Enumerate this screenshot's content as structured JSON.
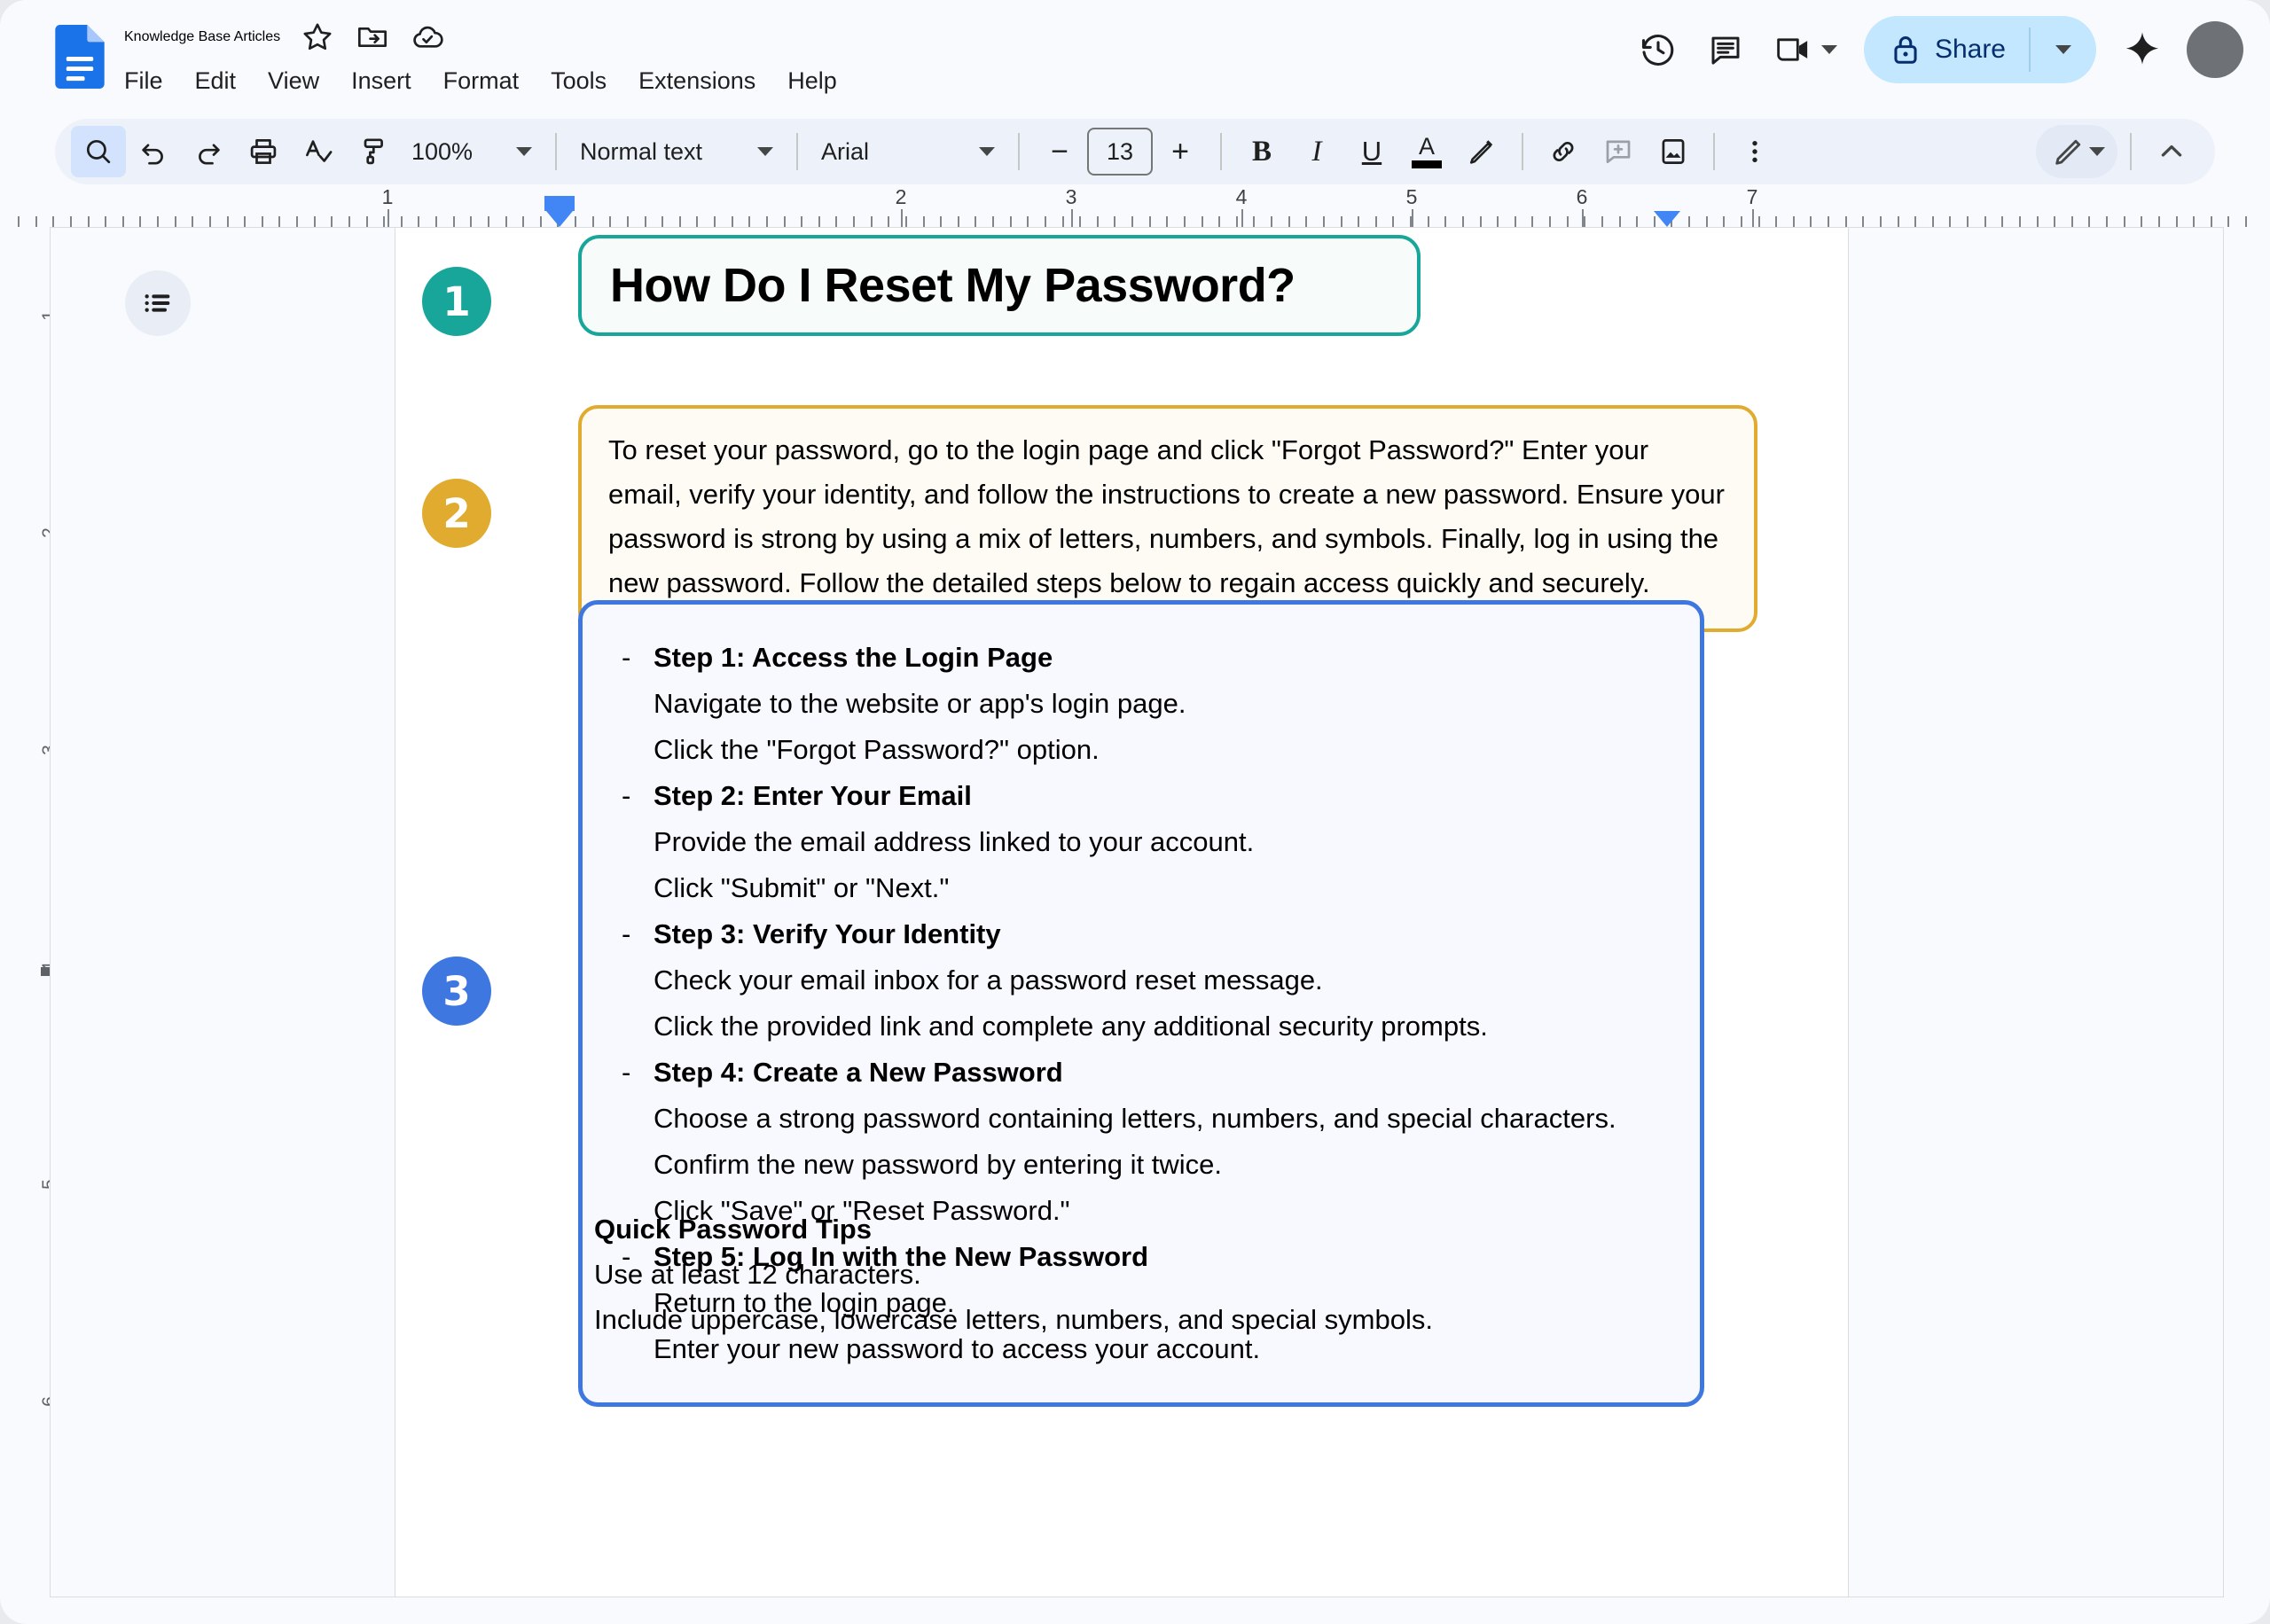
{
  "app": {
    "doc_title": "Knowledge Base Articles",
    "title_icons": [
      "star-icon",
      "move-to-folder-icon",
      "cloud-saved-icon"
    ],
    "menu": [
      "File",
      "Edit",
      "View",
      "Insert",
      "Format",
      "Tools",
      "Extensions",
      "Help"
    ],
    "header_right": {
      "history_icon": "version-history-icon",
      "comments_icon": "comment-history-icon",
      "meet_icon": "google-meet-icon",
      "share_label": "Share",
      "share_lock_icon": "lock-icon",
      "gemini_icon": "gemini-sparkle-icon",
      "avatar": "user-avatar"
    }
  },
  "toolbar": {
    "search": "search-icon",
    "undo": "undo-icon",
    "redo": "redo-icon",
    "print": "print-icon",
    "spellcheck": "spellcheck-icon",
    "paint_format": "paint-format-icon",
    "zoom_value": "100%",
    "style_value": "Normal text",
    "font_value": "Arial",
    "font_size_decrease": "−",
    "font_size_value": "13",
    "font_size_increase": "+",
    "bold": "B",
    "italic": "I",
    "underline": "U",
    "text_color": "A",
    "highlight": "highlight-pen-icon",
    "link": "insert-link-icon",
    "comment": "add-comment-icon",
    "image": "insert-image-icon",
    "more": "more-options-icon",
    "edit_mode": "edit-pencil-icon",
    "collapse": "collapse-toolbar-icon"
  },
  "ruler": {
    "horizontal_numbers": [
      "1",
      "1",
      "2",
      "3",
      "4",
      "5",
      "6",
      "7"
    ],
    "vertical_numbers": [
      "1",
      "2",
      "3",
      "4",
      "5",
      "6"
    ]
  },
  "document": {
    "outline_button": "document-outline-icon",
    "badges": [
      {
        "number": "1",
        "color": "#19a69a"
      },
      {
        "number": "2",
        "color": "#e0ab2e"
      },
      {
        "number": "3",
        "color": "#3f77e0"
      }
    ],
    "title": "How Do I Reset My Password?",
    "intro": "To reset your password, go to the login page and click \"Forgot Password?\" Enter your email, verify your identity, and follow the instructions to create a new password. Ensure your password is strong by using a mix of letters, numbers, and symbols. Finally, log in using the new password. Follow the detailed steps below to regain access quickly and securely.",
    "steps": [
      {
        "bullet": "-",
        "heading": "Step 1: Access the Login Page",
        "lines": [
          "Navigate to the website or app's login page.",
          "Click the \"Forgot Password?\" option."
        ]
      },
      {
        "bullet": "-",
        "heading": "Step 2: Enter Your Email",
        "lines": [
          "Provide the email address linked to your account.",
          "Click \"Submit\" or \"Next.\""
        ]
      },
      {
        "bullet": "-",
        "heading": "Step 3: Verify Your Identity",
        "lines": [
          "Check your email inbox for a password reset message.",
          "Click the provided link and complete any additional security prompts."
        ]
      },
      {
        "bullet": "-",
        "heading": "Step 4: Create a New Password",
        "lines": [
          "Choose a strong password containing letters, numbers, and special characters.",
          "Confirm the new password by entering it twice.",
          "Click \"Save\" or \"Reset Password.\""
        ]
      },
      {
        "bullet": "-",
        "heading": "Step 5: Log In with the New Password",
        "lines": [
          "Return to the login page.",
          "Enter your new password to access your account."
        ]
      }
    ],
    "tips": {
      "heading": "Quick Password Tips",
      "lines": [
        "Use at least 12 characters.",
        "Include uppercase, lowercase letters, numbers, and special symbols."
      ]
    }
  },
  "colors": {
    "teal": "#19a69a",
    "amber": "#e0ab2e",
    "blue": "#3f77e0",
    "share_bg": "#c2e7ff",
    "toolbar_bg": "#edf2fa"
  }
}
